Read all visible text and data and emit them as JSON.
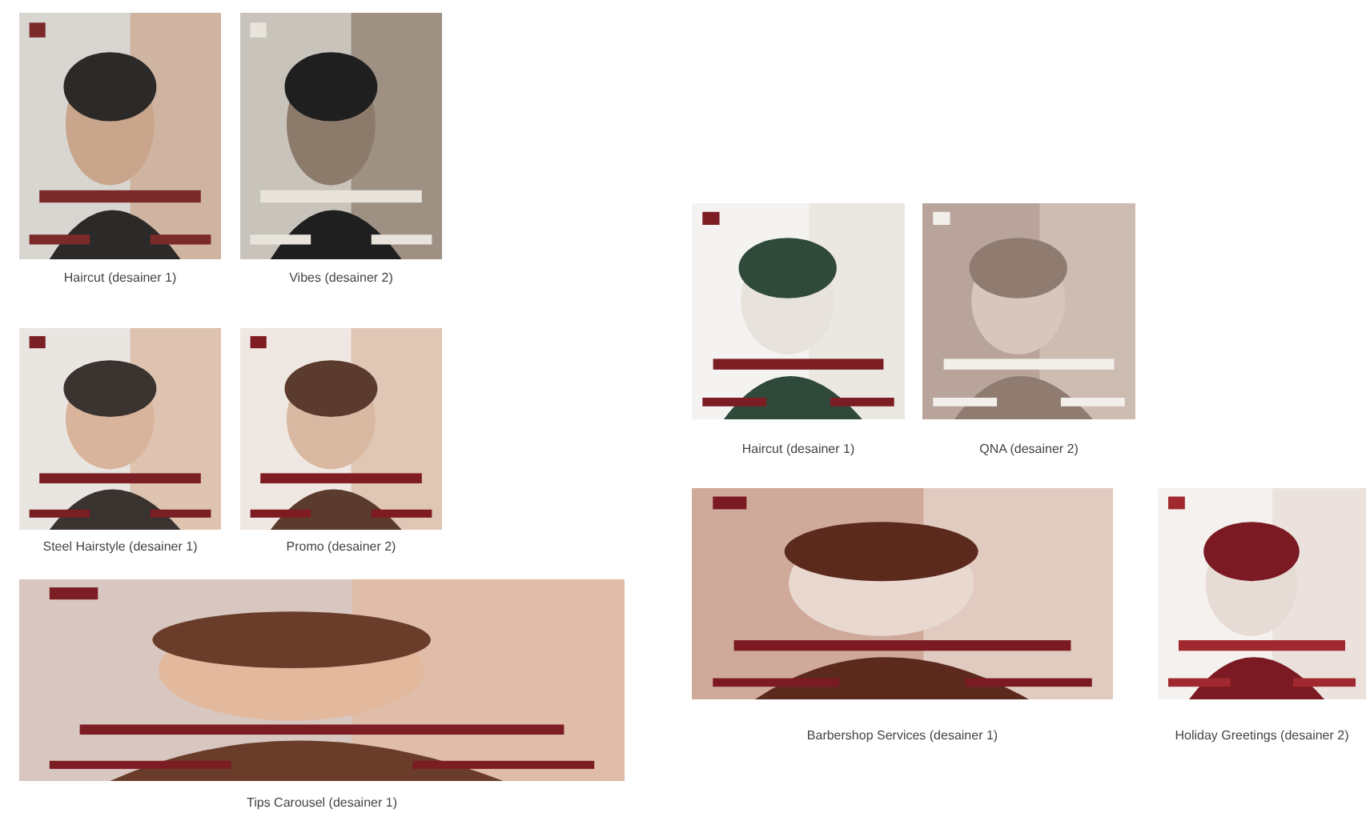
{
  "artboards": [
    {
      "caption": "Haircut (desainer 1)"
    },
    {
      "caption": "Vibes (desainer 2)"
    },
    {
      "caption": "Steel Hairstyle (desainer 1)"
    },
    {
      "caption": "Promo (desainer 2)"
    },
    {
      "caption": "Tips Carousel (desainer 1)"
    },
    {
      "caption": "Haircut (desainer 1)"
    },
    {
      "caption": "QNA (desainer 2)"
    },
    {
      "caption": "Barbershop Services (desainer 1)"
    },
    {
      "caption": "Holiday Greetings (desainer 2)"
    }
  ]
}
